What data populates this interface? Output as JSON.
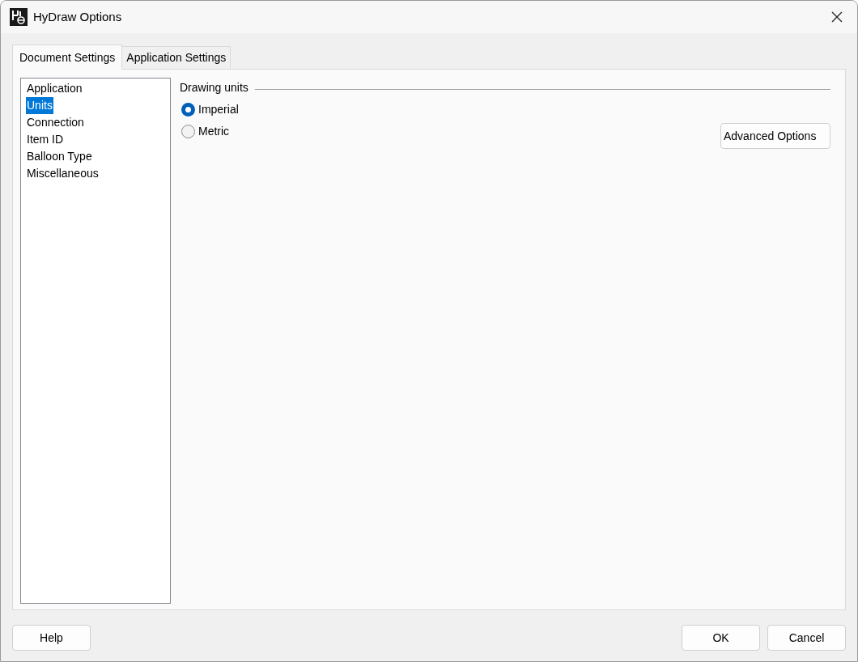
{
  "window": {
    "title": "HyDraw Options"
  },
  "tabs": [
    {
      "label": "Document Settings",
      "selected": true
    },
    {
      "label": "Application Settings",
      "selected": false
    }
  ],
  "sidebar": {
    "items": [
      {
        "label": "Application",
        "selected": false
      },
      {
        "label": "Units",
        "selected": true
      },
      {
        "label": "Connection",
        "selected": false
      },
      {
        "label": "Item ID",
        "selected": false
      },
      {
        "label": "Balloon Type",
        "selected": false
      },
      {
        "label": "Miscellaneous",
        "selected": false
      }
    ]
  },
  "group": {
    "title": "Drawing units",
    "options": [
      {
        "label": "Imperial",
        "selected": true
      },
      {
        "label": "Metric",
        "selected": false
      }
    ],
    "button": "Advanced Options"
  },
  "buttons": {
    "help": "Help",
    "ok": "OK",
    "cancel": "Cancel"
  }
}
